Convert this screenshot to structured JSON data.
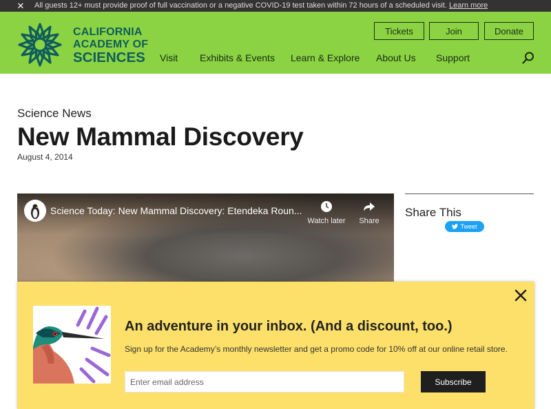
{
  "alert": {
    "close_glyph": "✕",
    "message": "All guests 12+ must provide proof of full vaccination or a negative COVID-19 test taken within 72 hours of a scheduled visit.",
    "link": "Learn more"
  },
  "header": {
    "logo": {
      "line1": "CALIFORNIA",
      "line2": "ACADEMY OF",
      "line3": "SCIENCES",
      "icon": "sunburst-logo"
    },
    "utility": [
      "Tickets",
      "Join",
      "Donate"
    ],
    "nav": [
      "Visit",
      "Exhibits & Events",
      "Learn & Explore",
      "About Us",
      "Support"
    ],
    "search_icon": "search-icon"
  },
  "article": {
    "kicker": "Science News",
    "title": "New Mammal Discovery",
    "date": "August 4, 2014"
  },
  "video": {
    "title": "Science Today: New Mammal Discovery: Etendeka Roun...",
    "watch_later": "Watch later",
    "share": "Share"
  },
  "share": {
    "title": "Share This",
    "tweet": "Tweet"
  },
  "newsletter": {
    "heading": "An adventure in your inbox. (And a discount, too.)",
    "body": "Sign up for the Academy’s monthly newsletter and get a promo code for 10% off at our online retail store.",
    "email_placeholder": "Enter email address",
    "subscribe": "Subscribe"
  },
  "colors": {
    "header_green": "#8bd343",
    "logo_teal": "#0f5d5c",
    "modal_yellow": "#fce069",
    "tweet_blue": "#1da1f2"
  }
}
